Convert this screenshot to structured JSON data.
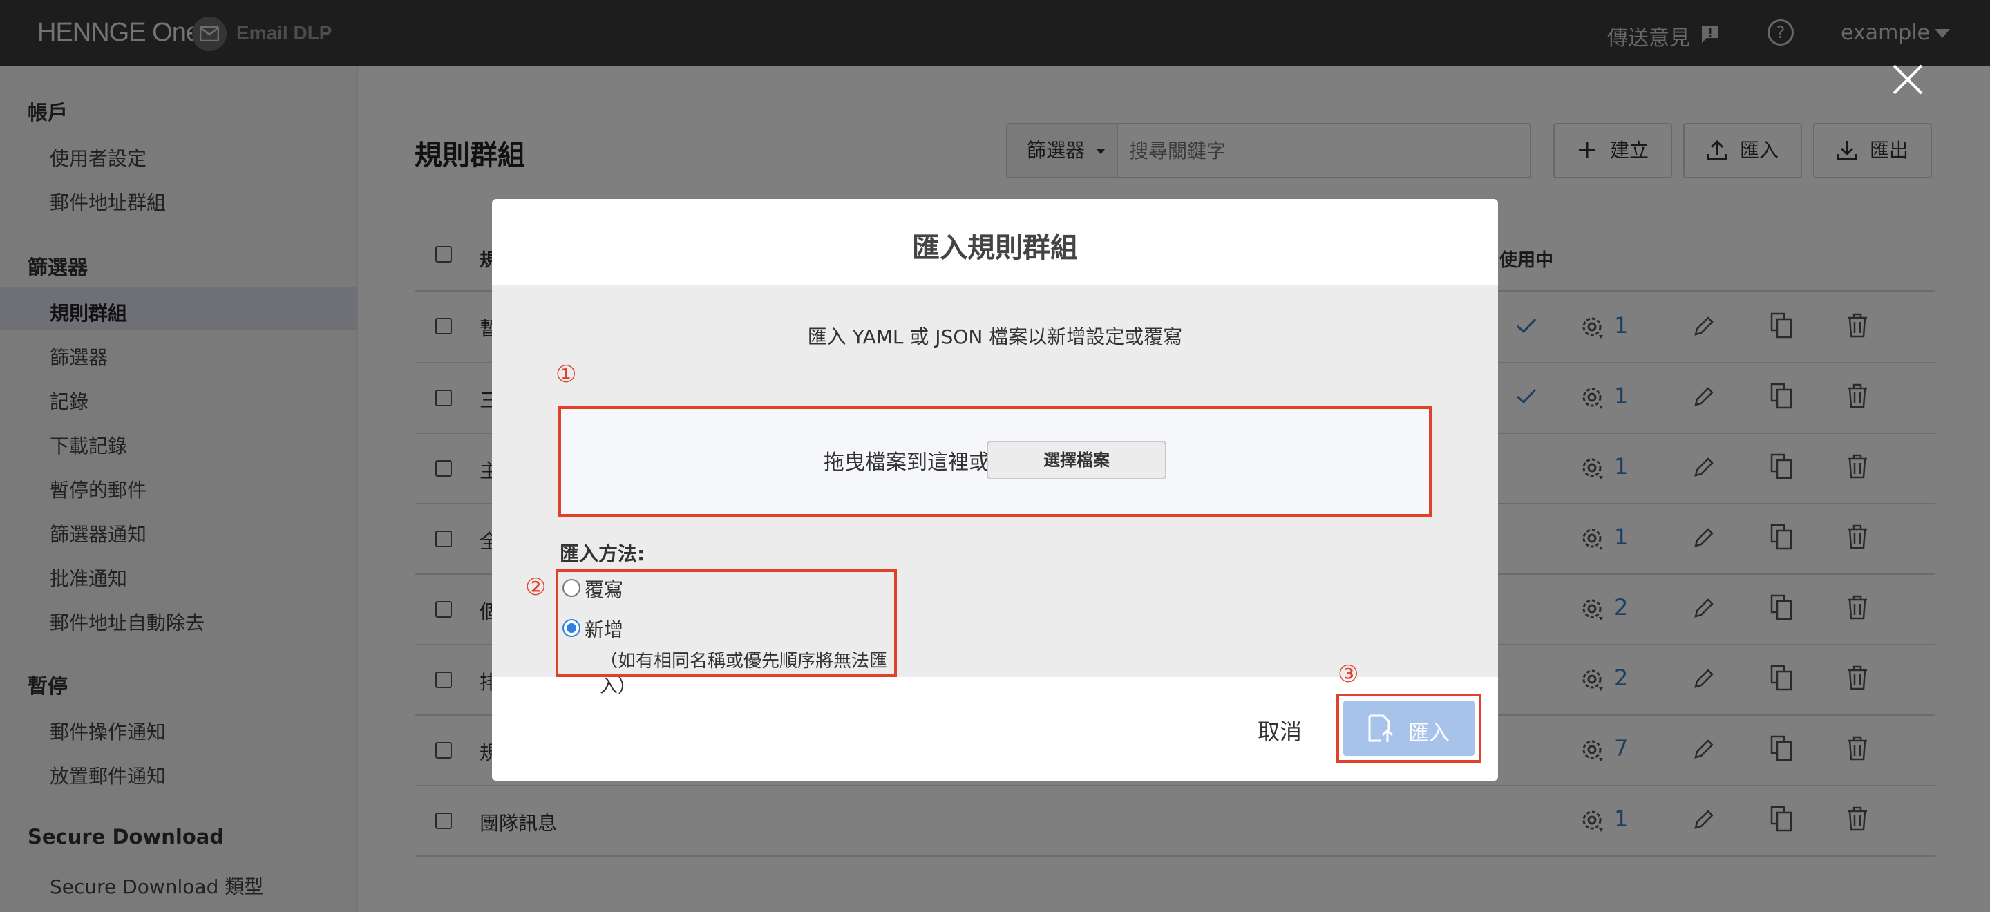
{
  "header": {
    "logo": "HENNGE One",
    "product": "Email DLP",
    "feedback": "傳送意見",
    "user": "example"
  },
  "sidebar": {
    "sections": [
      {
        "title": "帳戶",
        "items": [
          "使用者設定",
          "郵件地址群組"
        ]
      },
      {
        "title": "篩選器",
        "items": [
          "規則群組",
          "篩選器",
          "記錄",
          "下載記錄",
          "暫停的郵件",
          "篩選器通知",
          "批准通知",
          "郵件地址自動除去"
        ]
      },
      {
        "title": "暫停",
        "items": [
          "郵件操作通知",
          "放置郵件通知"
        ]
      },
      {
        "title": "Secure Download",
        "items": [
          "Secure Download 類型"
        ]
      }
    ],
    "active_item": "規則群組"
  },
  "main": {
    "title": "規則群組",
    "filter_label": "篩選器",
    "search_placeholder": "搜尋關鍵字",
    "create_label": "建立",
    "import_label": "匯入",
    "export_label": "匯出",
    "columns": {
      "name": "規",
      "in_use": "使用中"
    },
    "rows": [
      {
        "name": "暫",
        "in_use": true,
        "count": "1"
      },
      {
        "name": "三",
        "in_use": true,
        "count": "1"
      },
      {
        "name": "主",
        "in_use": false,
        "count": "1"
      },
      {
        "name": "全",
        "in_use": false,
        "count": "1"
      },
      {
        "name": "個",
        "in_use": false,
        "count": "2"
      },
      {
        "name": "排",
        "in_use": false,
        "count": "2"
      },
      {
        "name": "規",
        "in_use": false,
        "count": "7"
      },
      {
        "name": "團隊訊息",
        "in_use": false,
        "count": "1"
      }
    ]
  },
  "modal": {
    "title": "匯入規則群組",
    "instruction": "匯入 YAML 或 JSON 檔案以新增設定或覆寫",
    "drop_text": "拖曳檔案到這裡或",
    "choose_file": "選擇檔案",
    "method_label": "匯入方法:",
    "options": [
      {
        "label": "覆寫",
        "selected": false
      },
      {
        "label": "新增",
        "selected": true
      }
    ],
    "add_note": "（如有相同名稱或優先順序將無法匯入）",
    "cancel": "取消",
    "import": "匯入",
    "markers": [
      "①",
      "②",
      "③"
    ]
  },
  "colors": {
    "accent": "#3a7fc1",
    "highlight": "#e0412b",
    "import_button": "#a7c3ea",
    "topbar": "#3a3a3a"
  }
}
